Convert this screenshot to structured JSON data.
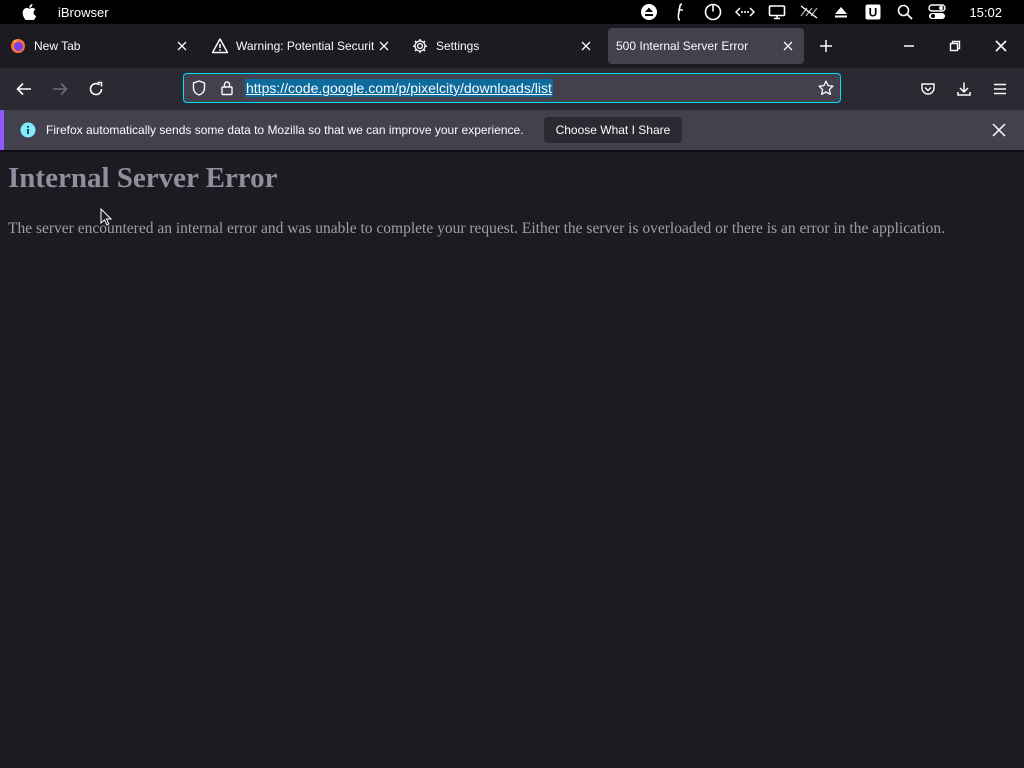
{
  "menubar": {
    "app_name": "iBrowser",
    "clock": "15:02"
  },
  "tabs": [
    {
      "label": "New Tab",
      "icon": "firefox-icon"
    },
    {
      "label": "Warning: Potential Security",
      "icon": "warning-icon"
    },
    {
      "label": "Settings",
      "icon": "gear-icon"
    },
    {
      "label": "500 Internal Server Error",
      "icon": ""
    }
  ],
  "navbar": {
    "url": "https://code.google.com/p/pixelcity/downloads/list"
  },
  "notification": {
    "text": "Firefox automatically sends some data to Mozilla so that we can improve your experience.",
    "button": "Choose What I Share"
  },
  "page": {
    "title": "Internal Server Error",
    "message": "The server encountered an internal error and was unable to complete your request. Either the server is overloaded or there is an error in the application."
  },
  "colors": {
    "accent": "#00ddff",
    "url_highlight": "#0d6b9c",
    "notif_stripe": "#9059ff"
  }
}
